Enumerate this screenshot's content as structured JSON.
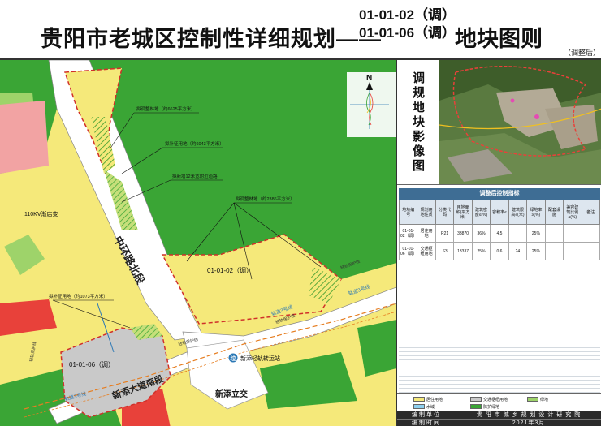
{
  "header": {
    "title_main": "贵阳市老城区控制性详细规划——",
    "code_line_1": "01-01-02（调）",
    "code_line_2": "01-01-06（调）",
    "title_tail": "地块图则",
    "adjusted_note": "（调整后）"
  },
  "map": {
    "colors": {
      "forest_green": "#3aa535",
      "road_white": "#ffffff",
      "residential_yellow": "#f5e97a",
      "commercial_red": "#e8413a",
      "transport_grey": "#c9c9c9",
      "substation_blue": "#2b78b5",
      "light_green": "#9ed36a",
      "pink_zone": "#f2a3a3"
    },
    "labels": {
      "substation": "110KV渐店变",
      "railway": "中环路北段",
      "parcel_02": "01-01-02（调）",
      "parcel_06": "01-01-06（调）",
      "road_south": "新添大道南段",
      "interchange": "新添立交",
      "transfer_station": "新添轻轨转运站",
      "station_marker": "垃",
      "annot_1": "拟调整林地（约6625平方米）",
      "annot_2": "拟补征用地（约6043平方米）",
      "annot_3": "拟新增12米宽附近道路",
      "annot_4": "拟调整林地（约2386平方米）",
      "annot_5": "拟补征用地（约1073平方米）",
      "metro_1": "轨道3号线",
      "metro_2": "轨道3号线",
      "metro_3": "轨道3号线",
      "protect_1": "轻轨保护线",
      "protect_2": "轻轨保护线",
      "protect_3": "轻轨保护线",
      "protect_4": "轻轨保护线",
      "north": "N"
    }
  },
  "panel": {
    "image_label": "调规地块影像图",
    "table_title": "调整后控制指标",
    "table_headers": [
      "地块编号",
      "规划用地性质",
      "分类代码",
      "用地面积(平方米)",
      "建筑密度≤(%)",
      "容积率≤",
      "建筑限高≤(米)",
      "绿地率≥(%)",
      "配套设施",
      "兼容建筑比例≤(%)",
      "备注"
    ],
    "rows": [
      [
        "01-01-02（调）",
        "居住用地",
        "R21",
        "33870",
        "36%",
        "4.5",
        "",
        "25%",
        "",
        "",
        ""
      ],
      [
        "01-01-06（调）",
        "交通枢纽用地",
        "S3",
        "13337",
        "25%",
        "0.6",
        "24",
        "25%",
        "",
        "",
        ""
      ]
    ],
    "legend": [
      {
        "label": "居住用地",
        "color": "#f5e97a"
      },
      {
        "label": "交通枢纽用地",
        "color": "#c9c9c9"
      },
      {
        "label": "绿地",
        "color": "#9ed36a"
      },
      {
        "label": "水域",
        "color": "#8fd0ef"
      },
      {
        "label": "防护绿地",
        "color": "#3aa535"
      }
    ],
    "footer": {
      "unit_key": "编制单位",
      "unit_value": "贵 阳 市 城 乡 规 划 设 计 研 究 院",
      "date_key": "编制时间",
      "date_value": "2021年3月"
    }
  }
}
